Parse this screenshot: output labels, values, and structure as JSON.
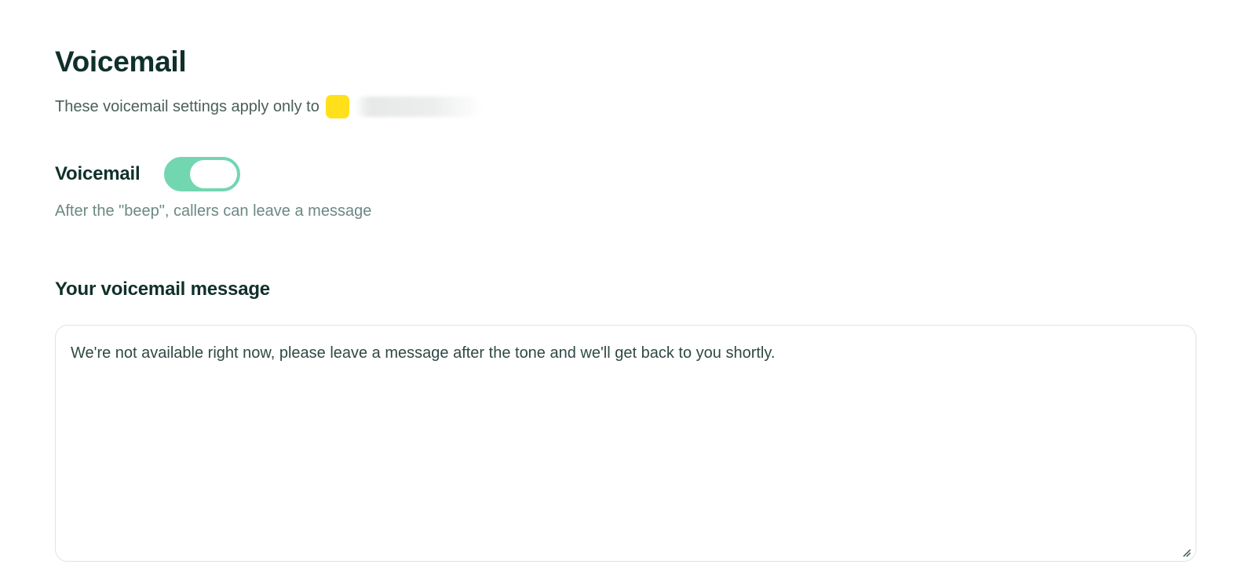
{
  "header": {
    "title": "Voicemail",
    "subtitle": "These voicemail settings apply only to",
    "line_badge_color": "#ffe01a"
  },
  "voicemail_setting": {
    "label": "Voicemail",
    "enabled": true,
    "toggle_color": "#72d6b1",
    "description": "After the \"beep\", callers can leave a message"
  },
  "message_section": {
    "heading": "Your voicemail message",
    "message": "We're not available right now, please leave a message after the tone and we'll get back to you shortly."
  }
}
